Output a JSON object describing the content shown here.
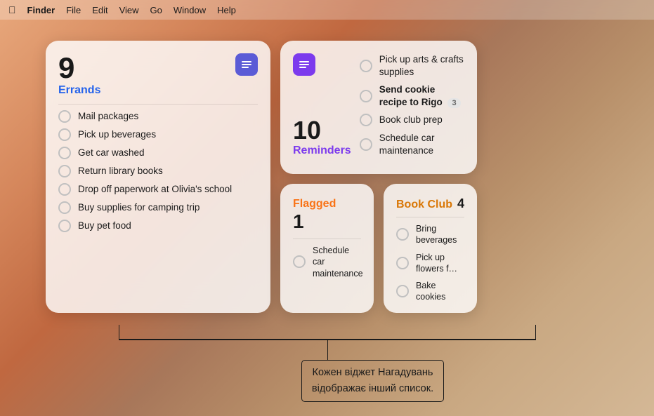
{
  "menubar": {
    "apple": "⌘",
    "items": [
      {
        "label": "Finder",
        "bold": true
      },
      {
        "label": "File"
      },
      {
        "label": "Edit"
      },
      {
        "label": "View"
      },
      {
        "label": "Go"
      },
      {
        "label": "Window"
      },
      {
        "label": "Help"
      }
    ]
  },
  "errands_widget": {
    "count": "9",
    "title": "Errands",
    "tasks": [
      {
        "text": "Mail packages"
      },
      {
        "text": "Pick up beverages"
      },
      {
        "text": "Get car washed"
      },
      {
        "text": "Return library books"
      },
      {
        "text": "Drop off paperwork at Olivia's school"
      },
      {
        "text": "Buy supplies for camping trip"
      },
      {
        "text": "Buy pet food"
      }
    ]
  },
  "reminders_widget": {
    "count": "10",
    "title": "Reminders",
    "right_tasks": [
      {
        "text": "Pick up arts & crafts supplies",
        "bold": false
      },
      {
        "text": "Send cookie recipe to Rigo",
        "bold": true,
        "badge": "3"
      },
      {
        "text": "Book club prep",
        "bold": false
      },
      {
        "text": "Schedule car maintenance",
        "bold": false
      }
    ]
  },
  "flagged_widget": {
    "title": "Flagged",
    "count": "1",
    "tasks": [
      {
        "text": "Schedule car maintenance"
      }
    ]
  },
  "bookclub_widget": {
    "title": "Book Club",
    "count": "4",
    "tasks": [
      {
        "text": "Bring beverages"
      },
      {
        "text": "Pick up flowers f…"
      },
      {
        "text": "Bake cookies"
      }
    ]
  },
  "annotation": {
    "line1": "Кожен віджет Нагадувань",
    "line2": "відображає інший список."
  }
}
